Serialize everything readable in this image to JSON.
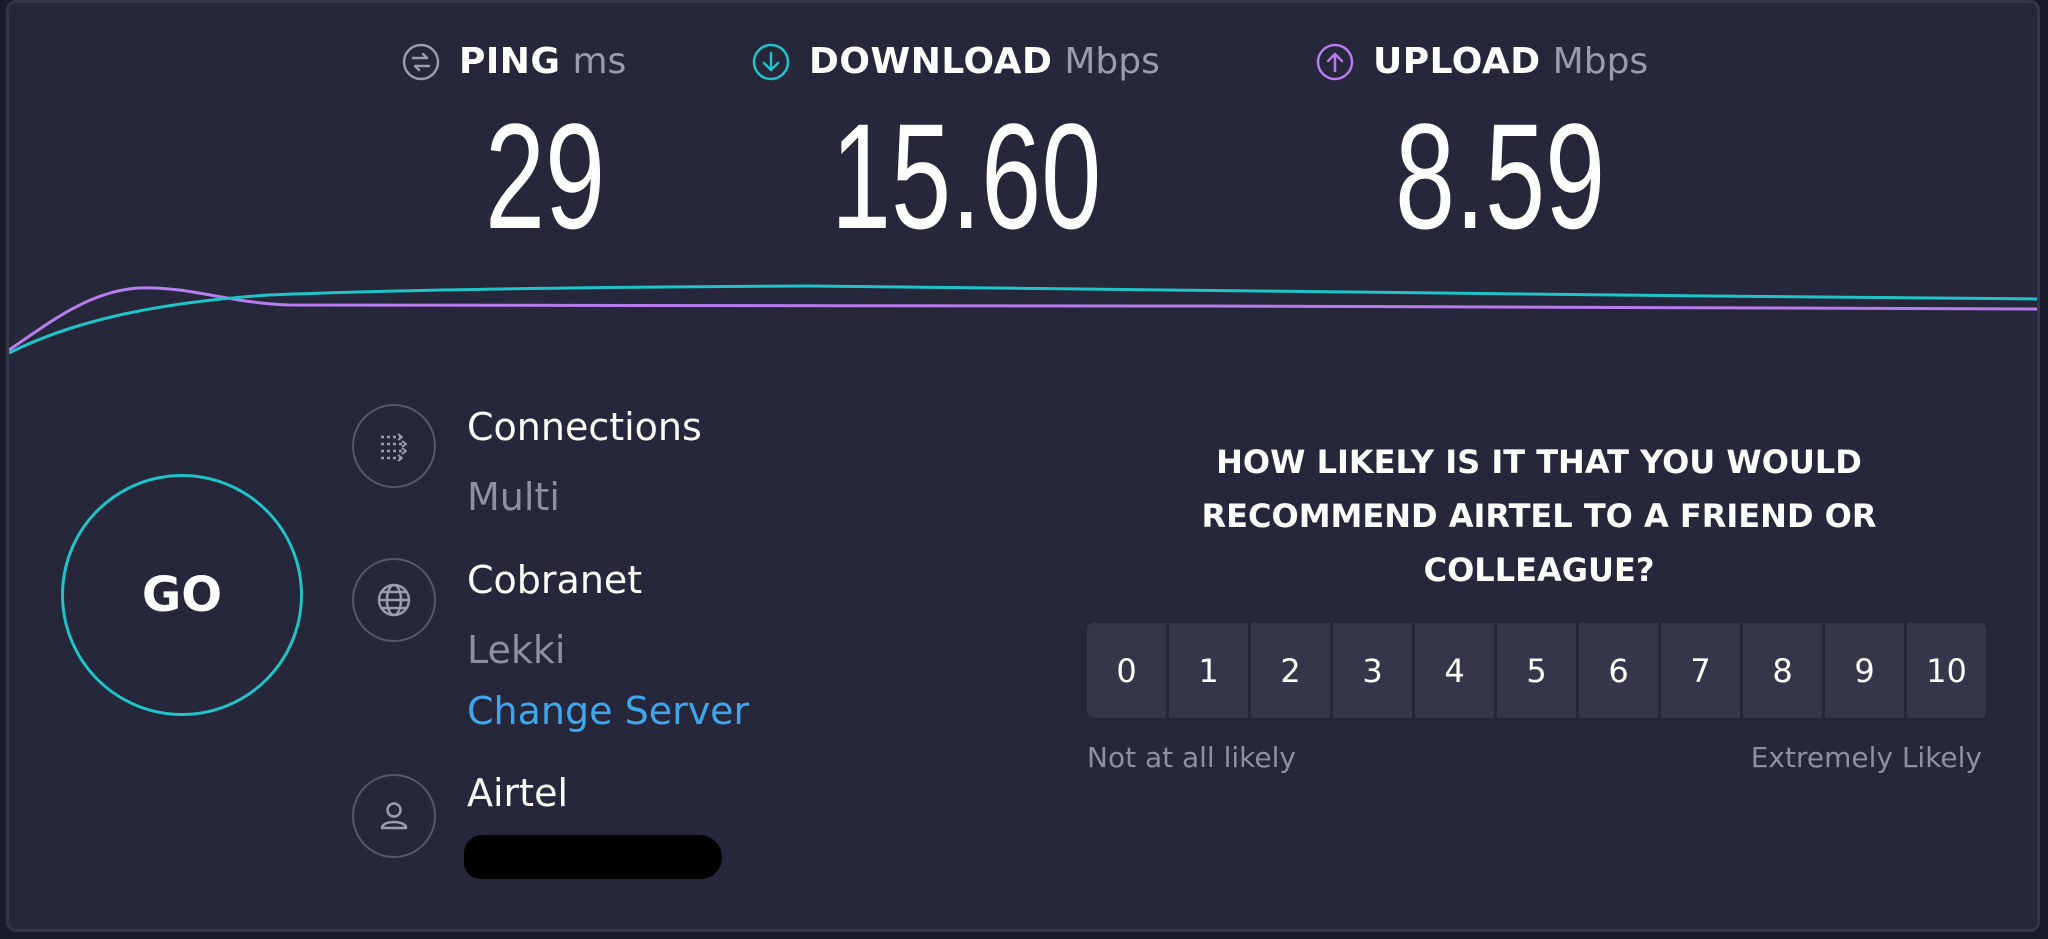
{
  "metrics": {
    "ping": {
      "label": "PING",
      "unit": "ms",
      "value": "29",
      "icon": "ping-icon",
      "color": "#9a9bad"
    },
    "download": {
      "label": "DOWNLOAD",
      "unit": "Mbps",
      "value": "15.60",
      "icon": "download-arrow-icon",
      "color": "#1fc4c8"
    },
    "upload": {
      "label": "UPLOAD",
      "unit": "Mbps",
      "value": "8.59",
      "icon": "upload-arrow-icon",
      "color": "#b77ded"
    }
  },
  "go_label": "GO",
  "connections": {
    "title": "Connections",
    "value": "Multi",
    "icon": "connections-icon"
  },
  "server": {
    "title": "Cobranet",
    "location": "Lekki",
    "change_label": "Change Server",
    "icon": "globe-icon"
  },
  "provider": {
    "title": "Airtel",
    "icon": "user-icon"
  },
  "survey": {
    "question": "HOW LIKELY IS IT THAT YOU WOULD RECOMMEND AIRTEL TO A FRIEND OR COLLEAGUE?",
    "options": [
      "0",
      "1",
      "2",
      "3",
      "4",
      "5",
      "6",
      "7",
      "8",
      "9",
      "10"
    ],
    "low_label": "Not at all likely",
    "high_label": "Extremely Likely"
  },
  "colors": {
    "background": "#26273b",
    "download_line": "#1fc4c8",
    "upload_line": "#b77ded",
    "link": "#3fa6ee"
  }
}
